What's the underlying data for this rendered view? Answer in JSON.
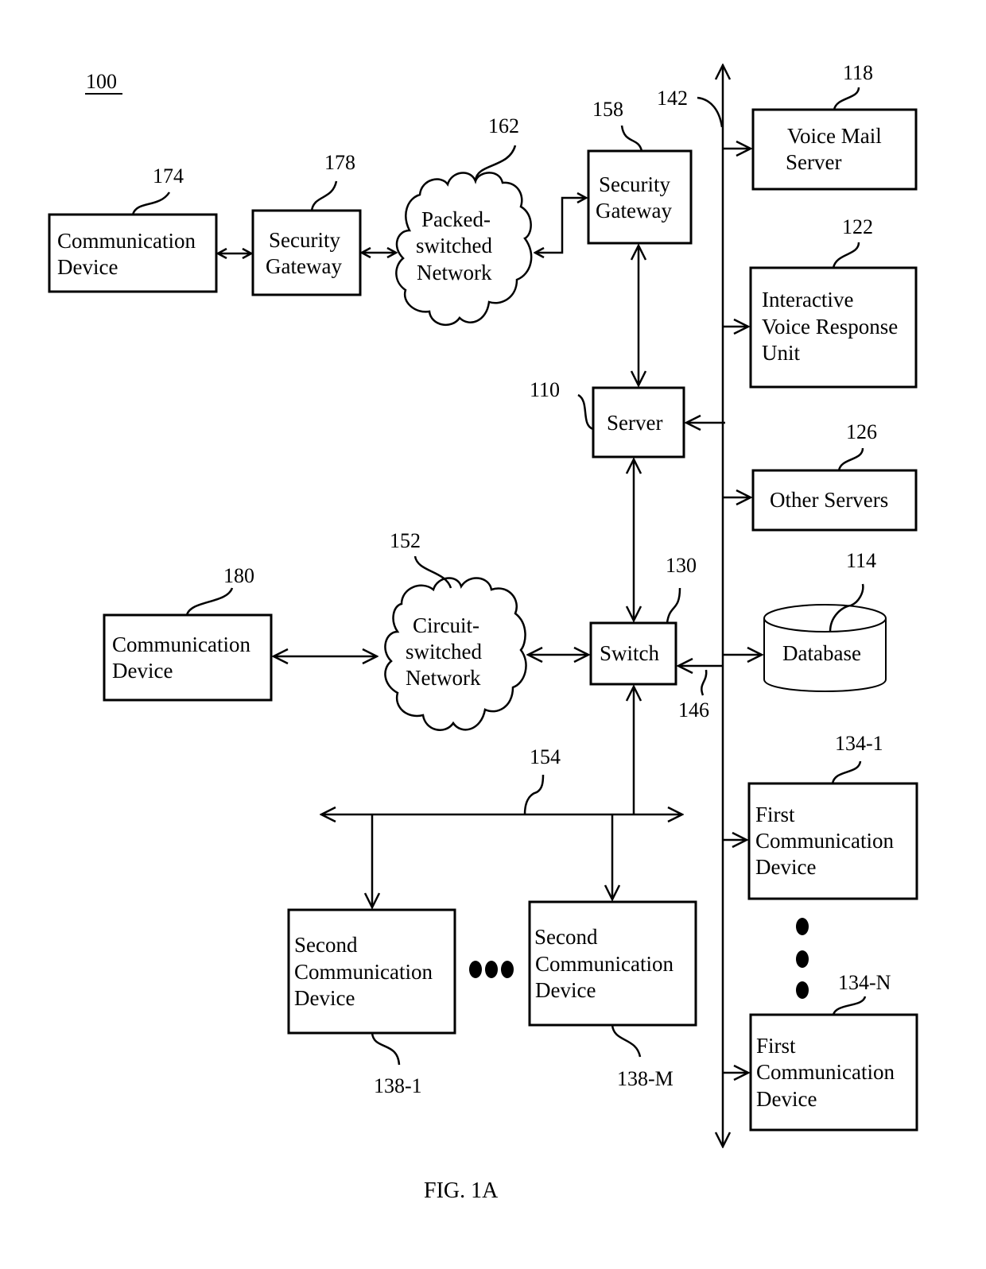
{
  "figure": {
    "ref": "100",
    "caption": "FIG. 1A"
  },
  "nodes": {
    "comm_device_174": {
      "ref": "174",
      "lines": [
        "Communication",
        "Device"
      ]
    },
    "security_gateway_178": {
      "ref": "178",
      "lines": [
        "Security",
        "Gateway"
      ]
    },
    "packet_network_162": {
      "ref": "162",
      "lines": [
        "Packed-",
        "switched",
        "Network"
      ]
    },
    "security_gateway_158": {
      "ref": "158",
      "lines": [
        "Security",
        "Gateway"
      ]
    },
    "bus_142": {
      "ref": "142"
    },
    "voice_mail_118": {
      "ref": "118",
      "lines": [
        "Voice Mail",
        "Server"
      ]
    },
    "ivr_122": {
      "ref": "122",
      "lines": [
        "Interactive",
        "Voice Response",
        "Unit"
      ]
    },
    "server_110": {
      "ref": "110",
      "lines": [
        "Server"
      ]
    },
    "other_servers_126": {
      "ref": "126",
      "lines": [
        "Other Servers"
      ]
    },
    "database_114": {
      "ref": "114",
      "lines": [
        "Database"
      ]
    },
    "switch_130": {
      "ref": "130",
      "lines": [
        "Switch"
      ]
    },
    "link_146": {
      "ref": "146"
    },
    "comm_device_180": {
      "ref": "180",
      "lines": [
        "Communication",
        "Device"
      ]
    },
    "circuit_network_152": {
      "ref": "152",
      "lines": [
        "Circuit-",
        "switched",
        "Network"
      ]
    },
    "lan_154": {
      "ref": "154"
    },
    "second_device_138_1": {
      "ref": "138-1",
      "lines": [
        "Second",
        "Communication",
        "Device"
      ]
    },
    "second_device_138_m": {
      "ref": "138-M",
      "lines": [
        "Second",
        "Communication",
        "Device"
      ]
    },
    "first_device_134_1": {
      "ref": "134-1",
      "lines": [
        "First",
        "Communication",
        "Device"
      ]
    },
    "first_device_134_n": {
      "ref": "134-N",
      "lines": [
        "First",
        "Communication",
        "Device"
      ]
    }
  }
}
